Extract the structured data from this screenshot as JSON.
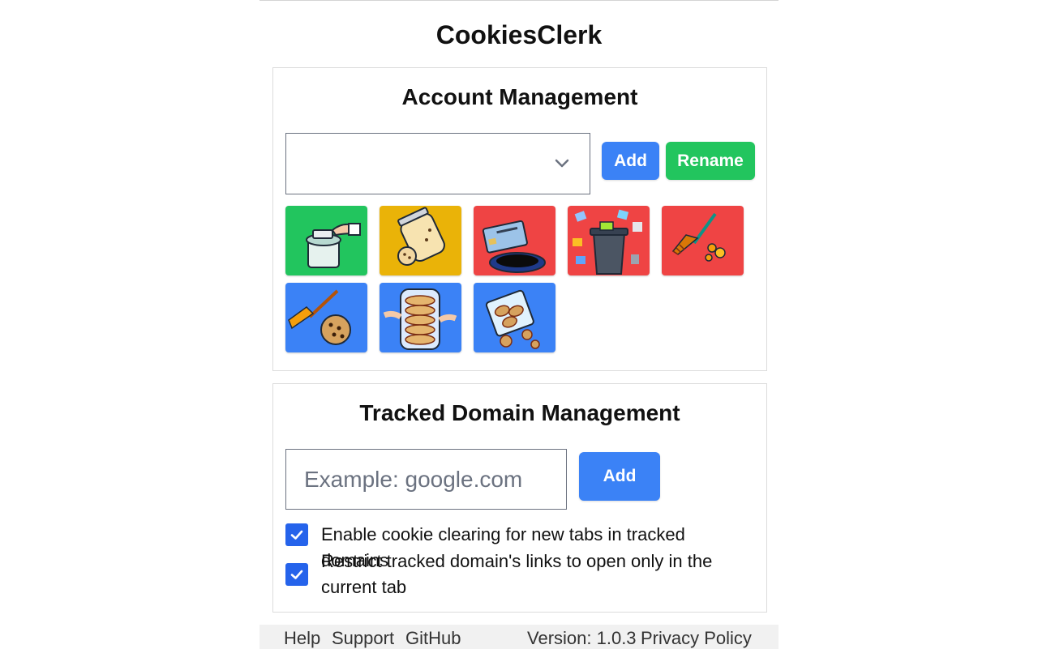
{
  "app": {
    "title": "CookiesClerk"
  },
  "account": {
    "title": "Account Management",
    "selected_account": "",
    "add_label": "Add",
    "rename_label": "Rename",
    "avatars": [
      {
        "name": "avatar-cookie-jar-hand",
        "bg": "#22c55e"
      },
      {
        "name": "avatar-cookie-jar-spill",
        "bg": "#eab308"
      },
      {
        "name": "avatar-account-card-bin",
        "bg": "#ef4444"
      },
      {
        "name": "avatar-trash-can-papers",
        "bg": "#ef4444"
      },
      {
        "name": "avatar-broom-crumbs",
        "bg": "#ef4444"
      },
      {
        "name": "avatar-broom-cookie",
        "bg": "#3b82f6"
      },
      {
        "name": "avatar-cookie-stack-jar",
        "bg": "#3b82f6"
      },
      {
        "name": "avatar-cookie-bag",
        "bg": "#3b82f6"
      }
    ]
  },
  "domains": {
    "title": "Tracked Domain Management",
    "input_placeholder": "Example: google.com",
    "add_label": "Add",
    "option_new_tabs": "Enable cookie clearing for new tabs in tracked domains",
    "option_restrict_links": "Restrict tracked domain's links to open only in the current tab",
    "option_new_tabs_checked": true,
    "option_restrict_links_checked": true
  },
  "footer": {
    "help": "Help",
    "support": "Support",
    "github": "GitHub",
    "version": "Version: 1.0.3",
    "privacy": "Privacy Policy"
  },
  "colors": {
    "primary": "#3b82f6",
    "success": "#22c55e",
    "checkbox": "#2563eb"
  }
}
